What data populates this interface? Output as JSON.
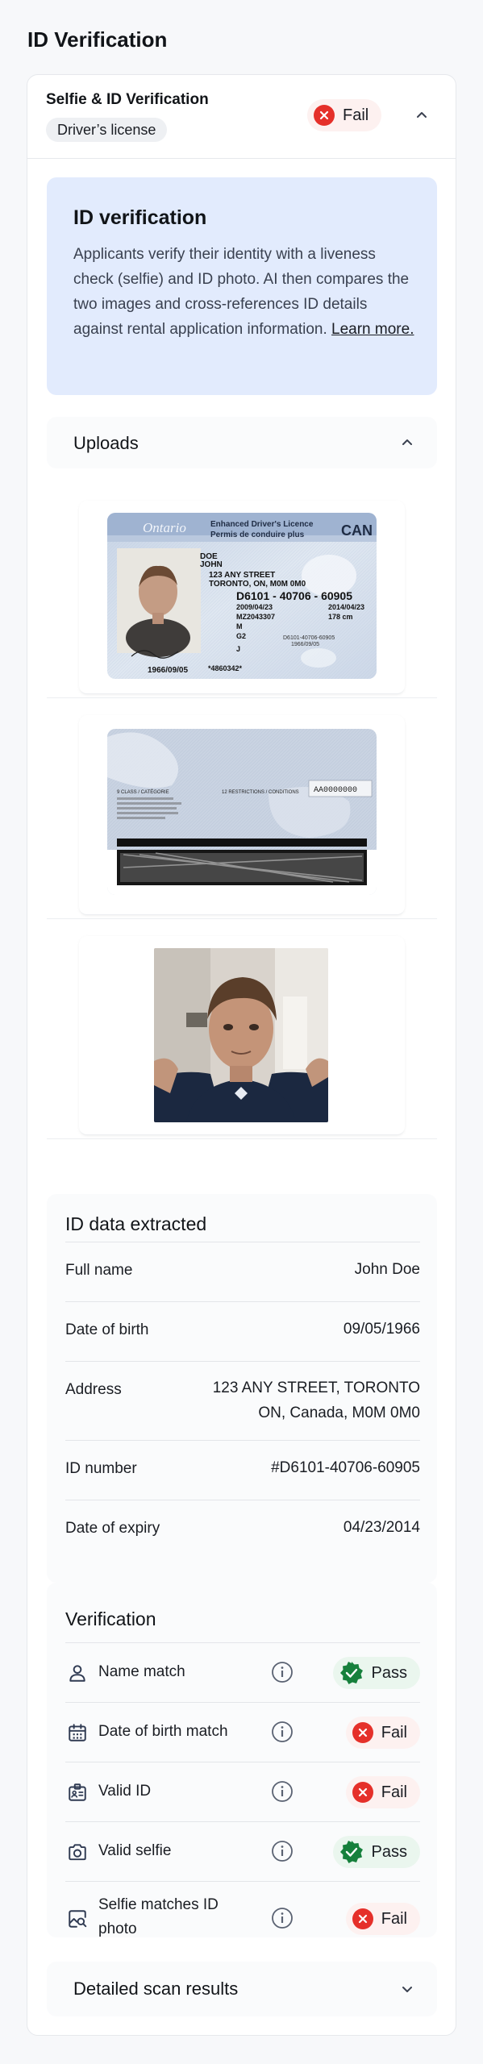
{
  "page": {
    "title": "ID Verification"
  },
  "card": {
    "title": "Selfie & ID Verification",
    "document_type": "Driver’s license",
    "status": "Fail"
  },
  "info_box": {
    "title": "ID verification",
    "text": "Applicants verify their identity with a liveness check (selfie) and ID photo. AI then compares the two images and cross-references ID details against rental application information.",
    "link": "Learn more."
  },
  "uploads": {
    "title": "Uploads",
    "front": {
      "header_left": "Ontario",
      "header_mid_1": "Enhanced Driver's Licence",
      "header_mid_2": "Permis de conduire plus",
      "country": "CAN",
      "last_name": "DOE",
      "first_name": "JOHN",
      "street": "123 ANY STREET",
      "city": "TORONTO, ON, M0M 0M0",
      "number": "D6101 - 40706 - 60905",
      "issued": "2009/04/23",
      "expiry": "2014/04/23",
      "ref": "MZ2043307",
      "height": "178 cm",
      "sex": "M",
      "class": "G2",
      "rest": "J",
      "dob": "1966/09/05",
      "card_no": "*4860342*",
      "small_no": "D6101-40706-60905",
      "small_dob": "1966/09/05"
    },
    "back": {
      "serial": "AA0000000",
      "class_label": "9 CLASS / CATÉGORIE",
      "restrictions_label": "12 RESTRICTIONS / CONDITIONS"
    }
  },
  "id_data": {
    "title": "ID data extracted",
    "rows": [
      {
        "label": "Full name",
        "value": "John Doe"
      },
      {
        "label": "Date of birth",
        "value": "09/05/1966"
      },
      {
        "label": "Address",
        "value_line1": "123 ANY STREET, TORONTO",
        "value_line2": "ON, Canada, M0M 0M0"
      },
      {
        "label": "ID number",
        "value": "#D6101-40706-60905"
      },
      {
        "label": "Date of expiry",
        "value": "04/23/2014"
      }
    ]
  },
  "verification": {
    "title": "Verification",
    "rows": [
      {
        "label": "Name match",
        "status": "Pass",
        "icon": "person-icon"
      },
      {
        "label": "Date of birth match",
        "status": "Fail",
        "icon": "calendar-icon"
      },
      {
        "label": "Valid ID",
        "status": "Fail",
        "icon": "id-card-icon"
      },
      {
        "label": "Valid selfie",
        "status": "Pass",
        "icon": "camera-icon"
      },
      {
        "label_line1": "Selfie matches ID",
        "label_line2": "photo",
        "status": "Fail",
        "icon": "image-search-icon"
      }
    ]
  },
  "detailed": {
    "title": "Detailed scan results"
  },
  "colors": {
    "fail": "#e5302a",
    "pass": "#16803c",
    "info_bg": "#e2ebfd"
  }
}
